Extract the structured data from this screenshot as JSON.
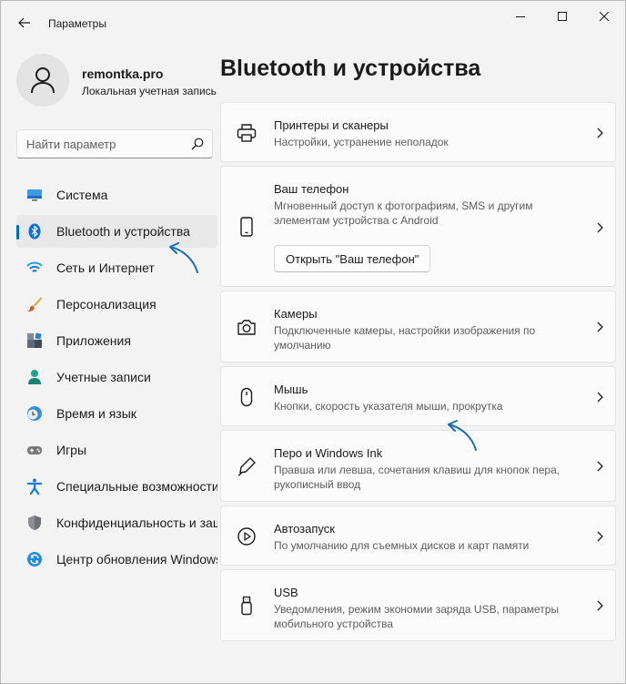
{
  "window": {
    "title": "Параметры"
  },
  "user": {
    "name": "remontka.pro",
    "account_type": "Локальная учетная запись"
  },
  "search": {
    "placeholder": "Найти параметр"
  },
  "nav": {
    "items": [
      {
        "label": "Система",
        "icon": "monitor-icon"
      },
      {
        "label": "Bluetooth и устройства",
        "icon": "bluetooth-icon",
        "active": true
      },
      {
        "label": "Сеть и Интернет",
        "icon": "wifi-icon"
      },
      {
        "label": "Персонализация",
        "icon": "brush-icon"
      },
      {
        "label": "Приложения",
        "icon": "apps-icon"
      },
      {
        "label": "Учетные записи",
        "icon": "person-icon"
      },
      {
        "label": "Время и язык",
        "icon": "clock-globe-icon"
      },
      {
        "label": "Игры",
        "icon": "gamepad-icon"
      },
      {
        "label": "Специальные возможности",
        "icon": "accessibility-icon"
      },
      {
        "label": "Конфиденциальность и защита",
        "icon": "shield-icon"
      },
      {
        "label": "Центр обновления Windows",
        "icon": "update-icon"
      }
    ]
  },
  "main": {
    "title": "Bluetooth и устройства",
    "cards": [
      {
        "title": "Принтеры и сканеры",
        "desc": "Настройки, устранение неполадок",
        "icon": "printer-icon"
      },
      {
        "title": "Ваш телефон",
        "desc": "Мгновенный доступ к фотографиям, SMS и другим элементам устройства с Android",
        "button": "Открыть \"Ваш телефон\"",
        "icon": "phone-icon"
      },
      {
        "title": "Камеры",
        "desc": "Подключенные камеры, настройки изображения по умолчанию",
        "icon": "camera-icon"
      },
      {
        "title": "Мышь",
        "desc": "Кнопки, скорость указателя мыши, прокрутка",
        "icon": "mouse-icon"
      },
      {
        "title": "Перо и Windows Ink",
        "desc": "Правша или левша, сочетания клавиш для кнопок пера, рукописный ввод",
        "icon": "pen-icon"
      },
      {
        "title": "Автозапуск",
        "desc": "По умолчанию для съемных дисков и карт памяти",
        "icon": "autoplay-icon"
      },
      {
        "title": "USB",
        "desc": "Уведомления, режим экономии заряда USB, параметры мобильного устройства",
        "icon": "usb-icon"
      }
    ]
  },
  "colors": {
    "accent": "#0067c0",
    "annotation_arrow": "#1a6fb0"
  }
}
